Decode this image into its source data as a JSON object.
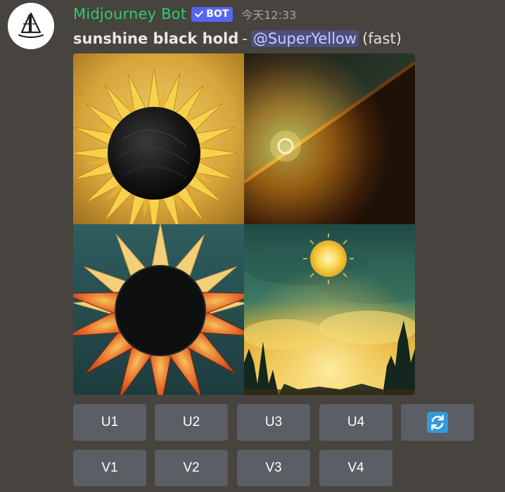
{
  "message": {
    "author": "Midjourney Bot",
    "badge": "BOT",
    "timestamp": "今天12:33",
    "prompt": "sunshine black hold",
    "separator": "-",
    "mention": "@SuperYellow",
    "mode": "(fast)"
  },
  "image": {
    "tiles": [
      "sunflower-black-center",
      "solar-horizon-glow",
      "eclipse-sun-petals",
      "sun-over-forest"
    ]
  },
  "buttons": {
    "upscale": [
      "U1",
      "U2",
      "U3",
      "U4"
    ],
    "variation": [
      "V1",
      "V2",
      "V3",
      "V4"
    ],
    "reroll_icon": "refresh-icon"
  },
  "colors": {
    "username": "#2ecc71",
    "badge": "#5865f2",
    "button": "#5b5e65",
    "background": "#47433e",
    "reroll": "#3498db"
  }
}
